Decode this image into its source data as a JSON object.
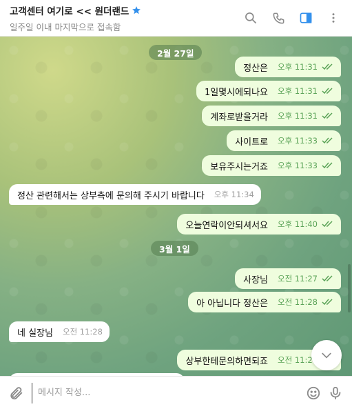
{
  "header": {
    "title": "고객센터 여기로 << 원더랜드",
    "subtitle": "일주일 이내 마지막으로 접속함"
  },
  "dates": [
    "2월 27일",
    "3월 1일"
  ],
  "messages": [
    {
      "text": "정산은",
      "time": "오후 11:31",
      "dir": "out"
    },
    {
      "text": "1일몇시에되나요",
      "time": "오후 11:31",
      "dir": "out"
    },
    {
      "text": "계좌로받을거라",
      "time": "오후 11:31",
      "dir": "out"
    },
    {
      "text": "사이트로",
      "time": "오후 11:33",
      "dir": "out"
    },
    {
      "text": "보유주시는거죠",
      "time": "오후 11:33",
      "dir": "out"
    },
    {
      "text": "정산 관련해서는 상부측에 문의해 주시기 바랍니다",
      "time": "오후 11:34",
      "dir": "in"
    },
    {
      "text": "오늘연락이안되셔서요",
      "time": "오후 11:40",
      "dir": "out"
    },
    {
      "text": "사장님",
      "time": "오전 11:27",
      "dir": "out"
    },
    {
      "text": "아 아닙니다 정산은",
      "time": "오전 11:28",
      "dir": "out"
    },
    {
      "text": "네 실장님",
      "time": "오전 11:28",
      "dir": "in"
    },
    {
      "text": "상부한테문의하면되죠",
      "time": "오전 11:28",
      "dir": "out"
    }
  ],
  "composer": {
    "placeholder": "메시지 작성..."
  },
  "colors": {
    "outgoing_bubble": "#effdde",
    "incoming_bubble": "#ffffff",
    "check_color": "#5aa357",
    "accent": "#3390ec"
  }
}
